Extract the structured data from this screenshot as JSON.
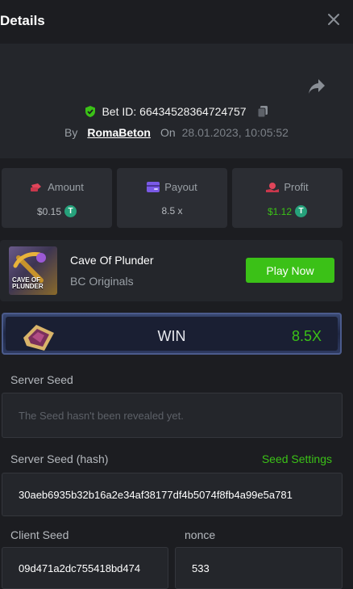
{
  "header": {
    "title": "Details"
  },
  "bet": {
    "id_label": "Bet ID: 66434528364724757",
    "by_label": "By",
    "user": "RomaBeton",
    "on_label": "On",
    "date": "28.01.2023, 10:05:52"
  },
  "stats": {
    "amount_label": "Amount",
    "amount_value": "$0.15",
    "payout_label": "Payout",
    "payout_value": "8.5 x",
    "profit_label": "Profit",
    "profit_value": "$1.12",
    "currency_icon": "T"
  },
  "game": {
    "name": "Cave Of Plunder",
    "provider": "BC Originals",
    "thumb_text_1": "CAVE OF",
    "thumb_text_2": "PLUNDER",
    "play_label": "Play Now"
  },
  "result": {
    "label": "WIN",
    "multiplier": "8.5X"
  },
  "fairness": {
    "server_seed_label": "Server Seed",
    "server_seed_placeholder": "The Seed hasn't been revealed yet.",
    "server_hash_label": "Server Seed (hash)",
    "seed_settings_label": "Seed Settings",
    "server_hash_value": "30aeb6935b32b16a2e34af38177df4b5074f8fb4a99e5a781",
    "client_seed_label": "Client Seed",
    "client_seed_value": "09d471a2dc755418bd474",
    "nonce_label": "nonce",
    "nonce_value": "533"
  },
  "colors": {
    "accent_green": "#3bc117",
    "background": "#1c1d21",
    "card": "#2b2d33"
  }
}
